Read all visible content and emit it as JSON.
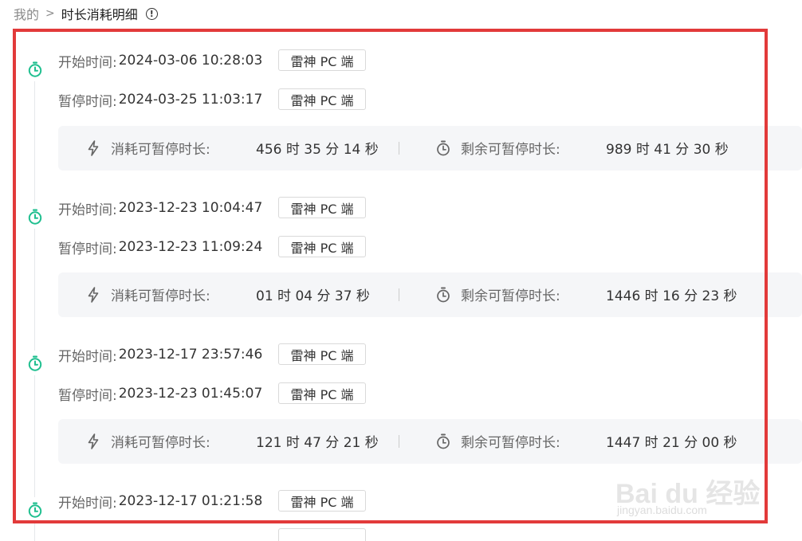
{
  "breadcrumb": {
    "parent": "我的",
    "separator": ">",
    "current": "时长消耗明细",
    "info_icon": "info-circle-icon"
  },
  "labels": {
    "start": "开始时间:",
    "pause": "暂停时间:",
    "consumed": "消耗可暂停时长:",
    "remaining": "剩余可暂停时长:"
  },
  "icons": {
    "node": "stopwatch-icon",
    "consumed": "lightning-icon",
    "remaining": "stopwatch-icon"
  },
  "colors": {
    "accent": "#1fbf8f",
    "annotation_frame": "#e23a3a"
  },
  "records": [
    {
      "start_time": "2024-03-06 10:28:03",
      "start_device": "雷神 PC 端",
      "pause_time": "2024-03-25 11:03:17",
      "pause_device": "雷神 PC 端",
      "consumed": "456 时 35 分 14 秒",
      "remaining": "989 时 41 分 30 秒"
    },
    {
      "start_time": "2023-12-23 10:04:47",
      "start_device": "雷神 PC 端",
      "pause_time": "2023-12-23 11:09:24",
      "pause_device": "雷神 PC 端",
      "consumed": "01 时 04 分 37 秒",
      "remaining": "1446 时 16 分 23 秒"
    },
    {
      "start_time": "2023-12-17 23:57:46",
      "start_device": "雷神 PC 端",
      "pause_time": "2023-12-23 01:45:07",
      "pause_device": "雷神 PC 端",
      "consumed": "121 时 47 分 21 秒",
      "remaining": "1447 时 21 分 00 秒"
    },
    {
      "start_time": "2023-12-17 01:21:58",
      "start_device": "雷神 PC 端"
    }
  ],
  "watermark": {
    "brand": "Bai du 经验",
    "url": "jingyan.baidu.com"
  }
}
